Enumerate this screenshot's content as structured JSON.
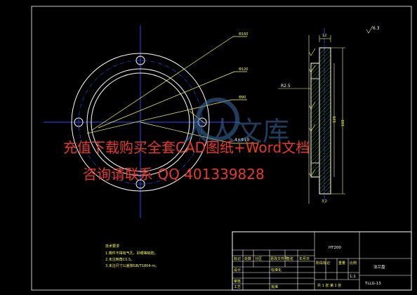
{
  "colors": {
    "background": "#000000",
    "frame": "#ffffff",
    "outline": "#ffffff",
    "centerline": "#2c4bff",
    "dimension": "#ffff55",
    "hatch": "#3fa34d",
    "watermark": "#e53a2c",
    "logo": "#3d6fa6"
  },
  "front_view": {
    "callout_top": "Φ160",
    "callout_mid": "Φ120",
    "callout_low": "Φ90",
    "hole_note": "4×Φ10"
  },
  "section_view": {
    "radius_label": "R2.5",
    "roughness_global": "6.3",
    "dim_height": "160",
    "dim_inner": "120",
    "dim_thick": "12",
    "dim_bottom": "3.2"
  },
  "notes": {
    "title": "技术要求",
    "lines": [
      "1.铸件不得有气孔、砂眼等缺陷。",
      "2.未注倒角C0.5。",
      "3.未注尺寸公差按GB/T1804-m。"
    ]
  },
  "title_block": {
    "material": "HT200",
    "part_name": "法兰盘",
    "drawing_number": "TLLG-13",
    "scale": "1:1",
    "sheet_text": "共 1 张   第 1 张",
    "header_labels": [
      "标记",
      "处数",
      "分区",
      "更改文件号",
      "签名",
      "年月日"
    ],
    "role_labels": [
      "设计",
      "审核",
      "工艺"
    ],
    "std_label": "标准化",
    "approve_label": "批准",
    "stage_labels": [
      "阶段标记",
      "重量",
      "比例"
    ]
  },
  "watermark": {
    "line1": "充值下载购买全套CAD图纸+Word文档",
    "line2": "咨询请联系 QQ 401339828",
    "logo_text": "人人文库"
  }
}
